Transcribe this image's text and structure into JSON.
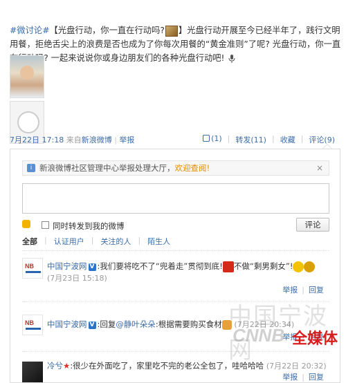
{
  "post": {
    "hashtag": "#微讨论#",
    "title": "【光盘行动，你一直在行动吗?",
    "title_end": "】",
    "body": "光盘行动开展至今已经半年了，践行文明用餐，拒绝舌尖上的浪费是否也成为了你每次用餐的“黄金准则”了呢? 光盘行动，你一直在行动吗? 一起来说说你或身边朋友们的各种光盘行动吧!"
  },
  "meta": {
    "time": "7月22日 17:18",
    "from_label": "来自",
    "source": "新浪微博",
    "report": "举报"
  },
  "actions": {
    "like": "(1)",
    "repost": "转发(11)",
    "favorite": "收藏",
    "comment": "评论(9)"
  },
  "notice": {
    "text": "新浪微博社区管理中心举报处理大厅，",
    "link": "欢迎查阅!",
    "close": "×"
  },
  "composer": {
    "repost_checkbox_label": "同时转发到我的微博",
    "submit": "评论"
  },
  "filters": {
    "all": "全部",
    "verified": "认证用户",
    "following": "关注的人",
    "strangers": "陌生人"
  },
  "comments": [
    {
      "author": "中国宁波网",
      "badge": "V",
      "text1": ":我们要将吃不了“兜着走”贯彻到底!",
      "text2": "不做“剩男剩女”!",
      "time": "(7月23日 15:18)",
      "report": "举报",
      "reply": "回复"
    },
    {
      "author": "中国宁波网",
      "badge": "V",
      "prefix": ":回复",
      "mention": "@静叶朵朵",
      "text": ":根据需要购买食材",
      "time": "(7月22日 20:34)",
      "report": "举报",
      "reply": "回复"
    },
    {
      "author": "冷兮",
      "text": ":很少在外面吃了，家里吃不完的老公全包了，哇哈哈哈",
      "time": "(7月22日 20:32)",
      "report": "举报",
      "reply": "回复"
    }
  ],
  "watermark": {
    "line1": "中国宁波网",
    "line2": "CNNB",
    "line3": "全媒体"
  }
}
